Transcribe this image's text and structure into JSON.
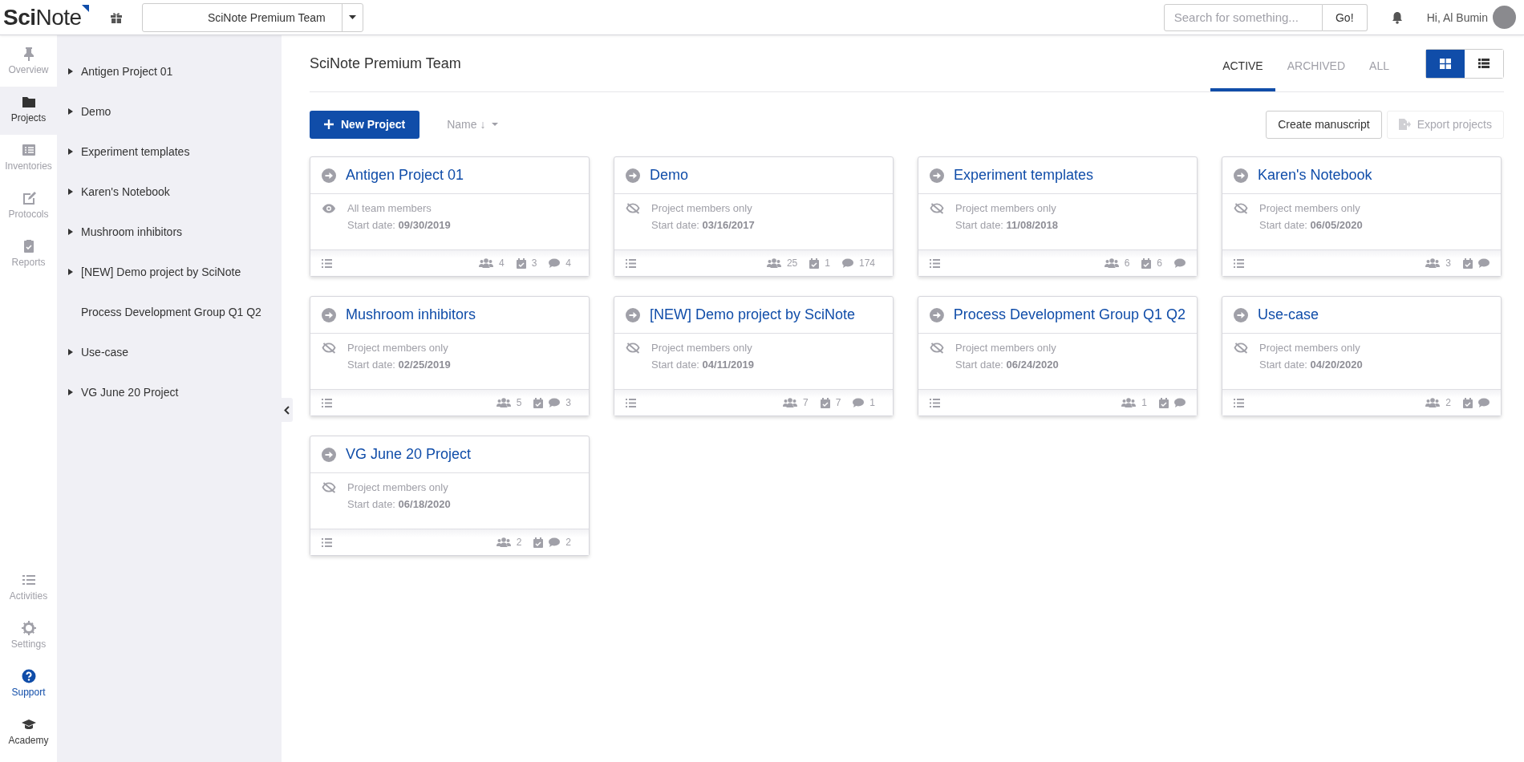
{
  "topbar": {
    "logo": "**Sci**Note",
    "team_select": "SciNote Premium Team",
    "search": {
      "placeholder": "Search for something..."
    },
    "search_button": "Go!",
    "greeting": "Hi, Al Bumin"
  },
  "nav": {
    "top": [
      {
        "kind": "pin",
        "label": "Overview",
        "selected": false
      },
      {
        "kind": "folder",
        "label": "Projects",
        "selected": true
      },
      {
        "kind": "list",
        "label": "Inventories",
        "selected": false
      },
      {
        "kind": "edit",
        "label": "Protocols",
        "selected": false
      },
      {
        "kind": "clipboard",
        "label": "Reports",
        "selected": false
      }
    ],
    "bottom": [
      {
        "kind": "activities",
        "label": "Activities",
        "color": "#a0a0a8"
      },
      {
        "kind": "gear",
        "label": "Settings",
        "color": "#a0a0a8"
      },
      {
        "kind": "help",
        "label": "Support",
        "color": "#104da9"
      },
      {
        "kind": "academy",
        "label": "Academy",
        "color": "#3b3b3b"
      }
    ]
  },
  "tree": {
    "items": [
      {
        "label": "Antigen Project 01",
        "expandable": true
      },
      {
        "label": "Demo",
        "expandable": true
      },
      {
        "label": "Experiment templates",
        "expandable": true
      },
      {
        "label": "Karen's Notebook",
        "expandable": true
      },
      {
        "label": "Mushroom inhibitors",
        "expandable": true
      },
      {
        "label": "[NEW] Demo project by SciNote",
        "expandable": true
      },
      {
        "label": "Process Development Group Q1 Q2",
        "expandable": false
      },
      {
        "label": "Use-case",
        "expandable": true
      },
      {
        "label": "VG June 20 Project",
        "expandable": true
      }
    ]
  },
  "main": {
    "title": "SciNote Premium Team",
    "tabs": [
      {
        "label": "ACTIVE",
        "selected": true
      },
      {
        "label": "ARCHIVED",
        "selected": false
      },
      {
        "label": "ALL",
        "selected": false
      }
    ],
    "view_modes": [
      {
        "kind": "grid",
        "selected": true
      },
      {
        "kind": "list",
        "selected": false
      }
    ],
    "new_project": "New Project",
    "sort": "Name ↓",
    "create_manuscript": {
      "label": "Create manuscript",
      "disabled": false
    },
    "export_projects": {
      "label": "Export projects",
      "disabled": true
    },
    "projects": [
      {
        "name": "Antigen Project 01",
        "visibility": {
          "kind": "all",
          "text": "All team members"
        },
        "start": "Start date: **09/30/2019**",
        "users": "4",
        "tasks": "3",
        "comments": "4"
      },
      {
        "name": "Demo",
        "visibility": {
          "kind": "members",
          "text": "Project members only"
        },
        "start": "Start date: **03/16/2017**",
        "users": "25",
        "tasks": "1",
        "comments": "174"
      },
      {
        "name": "Experiment templates",
        "visibility": {
          "kind": "members",
          "text": "Project members only"
        },
        "start": "Start date: **11/08/2018**",
        "users": "6",
        "tasks": "6"
      },
      {
        "name": "Karen's Notebook",
        "visibility": {
          "kind": "members",
          "text": "Project members only"
        },
        "start": "Start date: **06/05/2020**",
        "users": "3"
      },
      {
        "name": "Mushroom inhibitors",
        "visibility": {
          "kind": "members",
          "text": "Project members only"
        },
        "start": "Start date: **02/25/2019**",
        "users": "5",
        "comments": "3"
      },
      {
        "name": "[NEW] Demo project by SciNote",
        "visibility": {
          "kind": "members",
          "text": "Project members only"
        },
        "start": "Start date: **04/11/2019**",
        "users": "7",
        "tasks": "7",
        "comments": "1"
      },
      {
        "name": "Process Development Group Q1 Q2",
        "visibility": {
          "kind": "members",
          "text": "Project members only"
        },
        "start": "Start date: **06/24/2020**",
        "users": "1"
      },
      {
        "name": "Use-case",
        "visibility": {
          "kind": "members",
          "text": "Project members only"
        },
        "start": "Start date: **04/20/2020**",
        "users": "2"
      },
      {
        "name": "VG June 20 Project",
        "visibility": {
          "kind": "members",
          "text": "Project members only"
        },
        "start": "Start date: **06/18/2020**",
        "users": "2",
        "comments": "2"
      }
    ]
  }
}
